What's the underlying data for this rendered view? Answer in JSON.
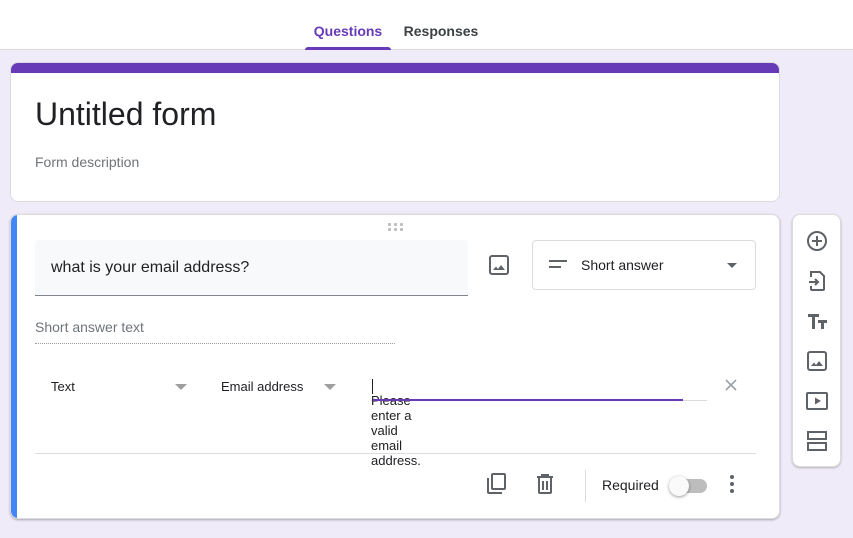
{
  "tabs": [
    {
      "label": "Questions",
      "active": true
    },
    {
      "label": "Responses",
      "active": false
    }
  ],
  "colors": {
    "accent": "#673ab7",
    "question_accent": "#4285f4",
    "background": "#f0ebf8"
  },
  "form": {
    "title": "Untitled form",
    "description_placeholder": "Form description"
  },
  "question": {
    "title": "what is your email address?",
    "type": {
      "icon": "short-answer-icon",
      "label": "Short answer"
    },
    "answer_placeholder": "Short answer text",
    "validation": {
      "category": "Text",
      "rule": "Email address",
      "error_text": "Please enter a valid email address."
    },
    "footer": {
      "required_label": "Required",
      "required": false
    }
  },
  "icons": {
    "drag": "drag-handle-icon",
    "add_image": "image-icon",
    "clear": "close-icon",
    "duplicate": "copy-icon",
    "delete": "trash-icon",
    "more": "more-vert-icon"
  },
  "side_toolbar": [
    {
      "icon": "add-circle-icon",
      "action": "Add question"
    },
    {
      "icon": "import-icon",
      "action": "Import questions"
    },
    {
      "icon": "title-icon",
      "action": "Add title and description"
    },
    {
      "icon": "image-icon",
      "action": "Add image"
    },
    {
      "icon": "video-icon",
      "action": "Add video"
    },
    {
      "icon": "section-icon",
      "action": "Add section"
    }
  ]
}
